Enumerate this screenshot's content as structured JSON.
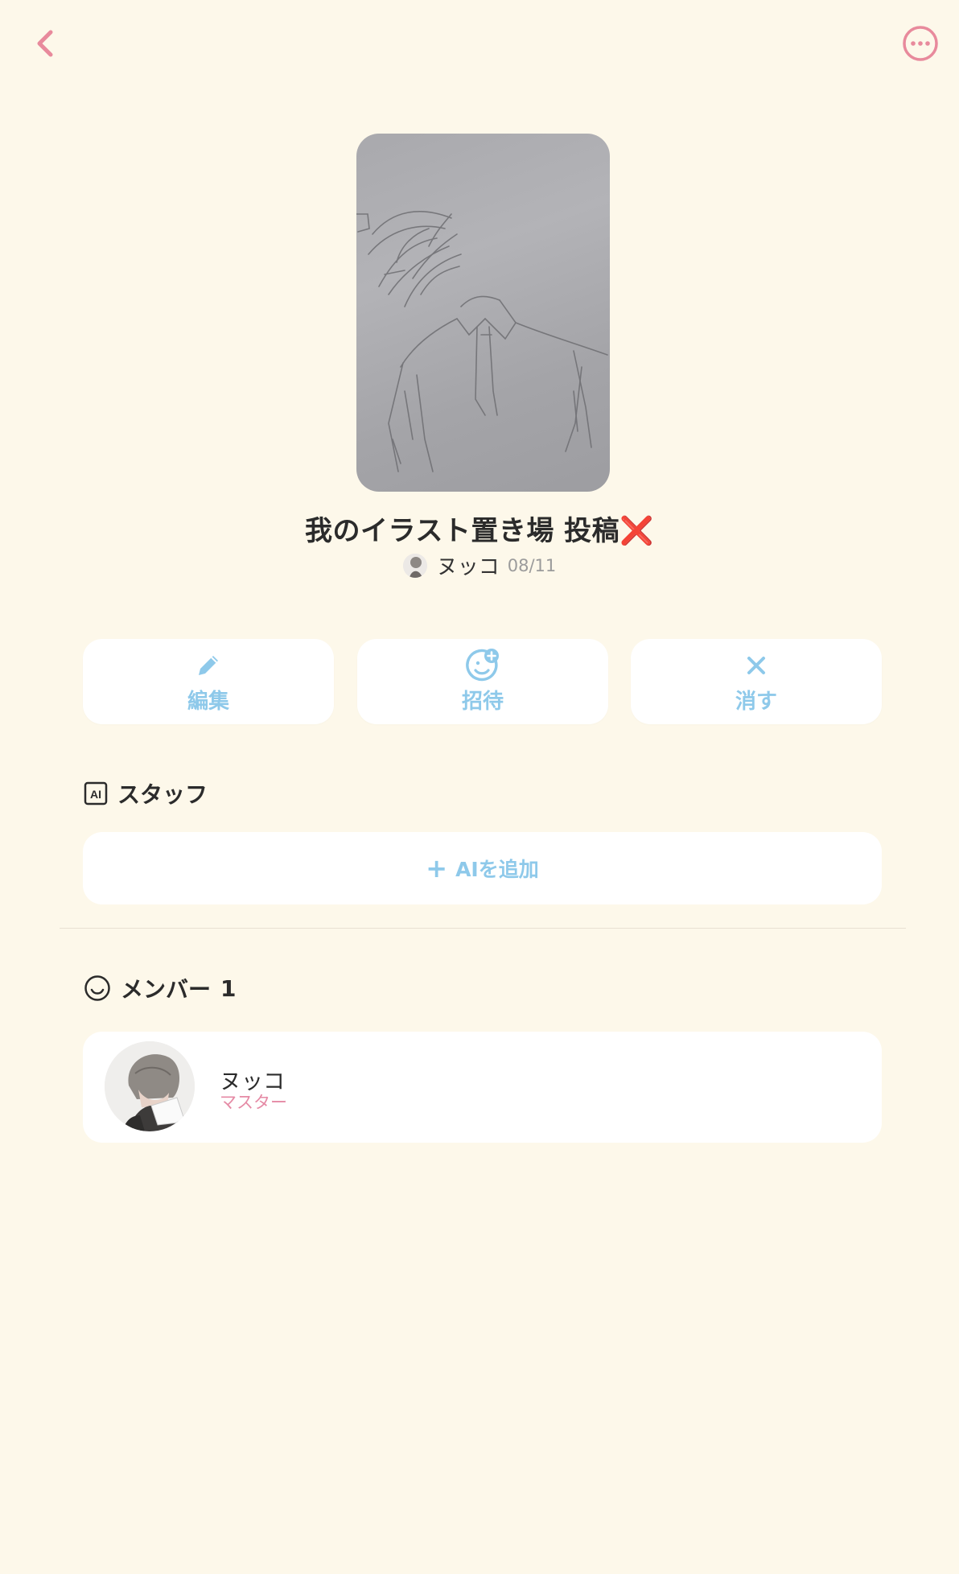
{
  "header": {
    "back_icon": "chevron-left-icon",
    "more_icon": "more-horizontal-circle-icon",
    "accent_color": "#e88a9c"
  },
  "room": {
    "title": "我のイラスト置き場 投稿",
    "title_emoji": "❌",
    "owner": "ヌッコ",
    "date": "08/11"
  },
  "actions": [
    {
      "label": "編集",
      "icon": "pencil-icon"
    },
    {
      "label": "招待",
      "icon": "add-user-smile-icon"
    },
    {
      "label": "消す",
      "icon": "close-icon"
    }
  ],
  "staff": {
    "heading": "スタッフ",
    "icon": "ai-badge-icon",
    "add_label": "AIを追加",
    "add_symbol": "+"
  },
  "members": {
    "heading": "メンバー",
    "count": "1",
    "icon": "smile-icon",
    "list": [
      {
        "name": "ヌッコ",
        "role": "マスター"
      }
    ]
  },
  "colors": {
    "background": "#fdf8ea",
    "button_text": "#8ec9ea",
    "role_text": "#e58aa5"
  }
}
